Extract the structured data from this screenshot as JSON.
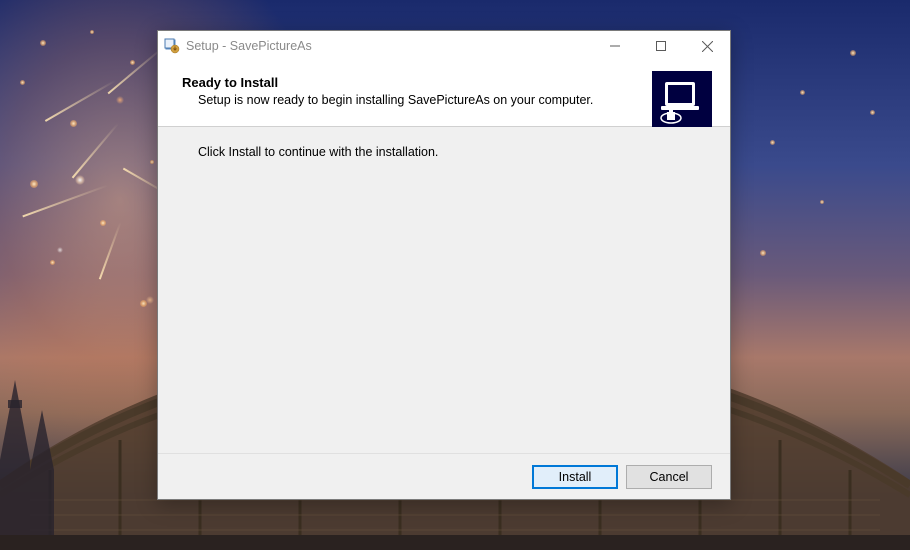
{
  "window": {
    "title": "Setup - SavePictureAs"
  },
  "header": {
    "title": "Ready to Install",
    "description": "Setup is now ready to begin installing SavePictureAs on your computer."
  },
  "body": {
    "instruction": "Click Install to continue with the installation."
  },
  "footer": {
    "install_label": "Install",
    "cancel_label": "Cancel"
  }
}
